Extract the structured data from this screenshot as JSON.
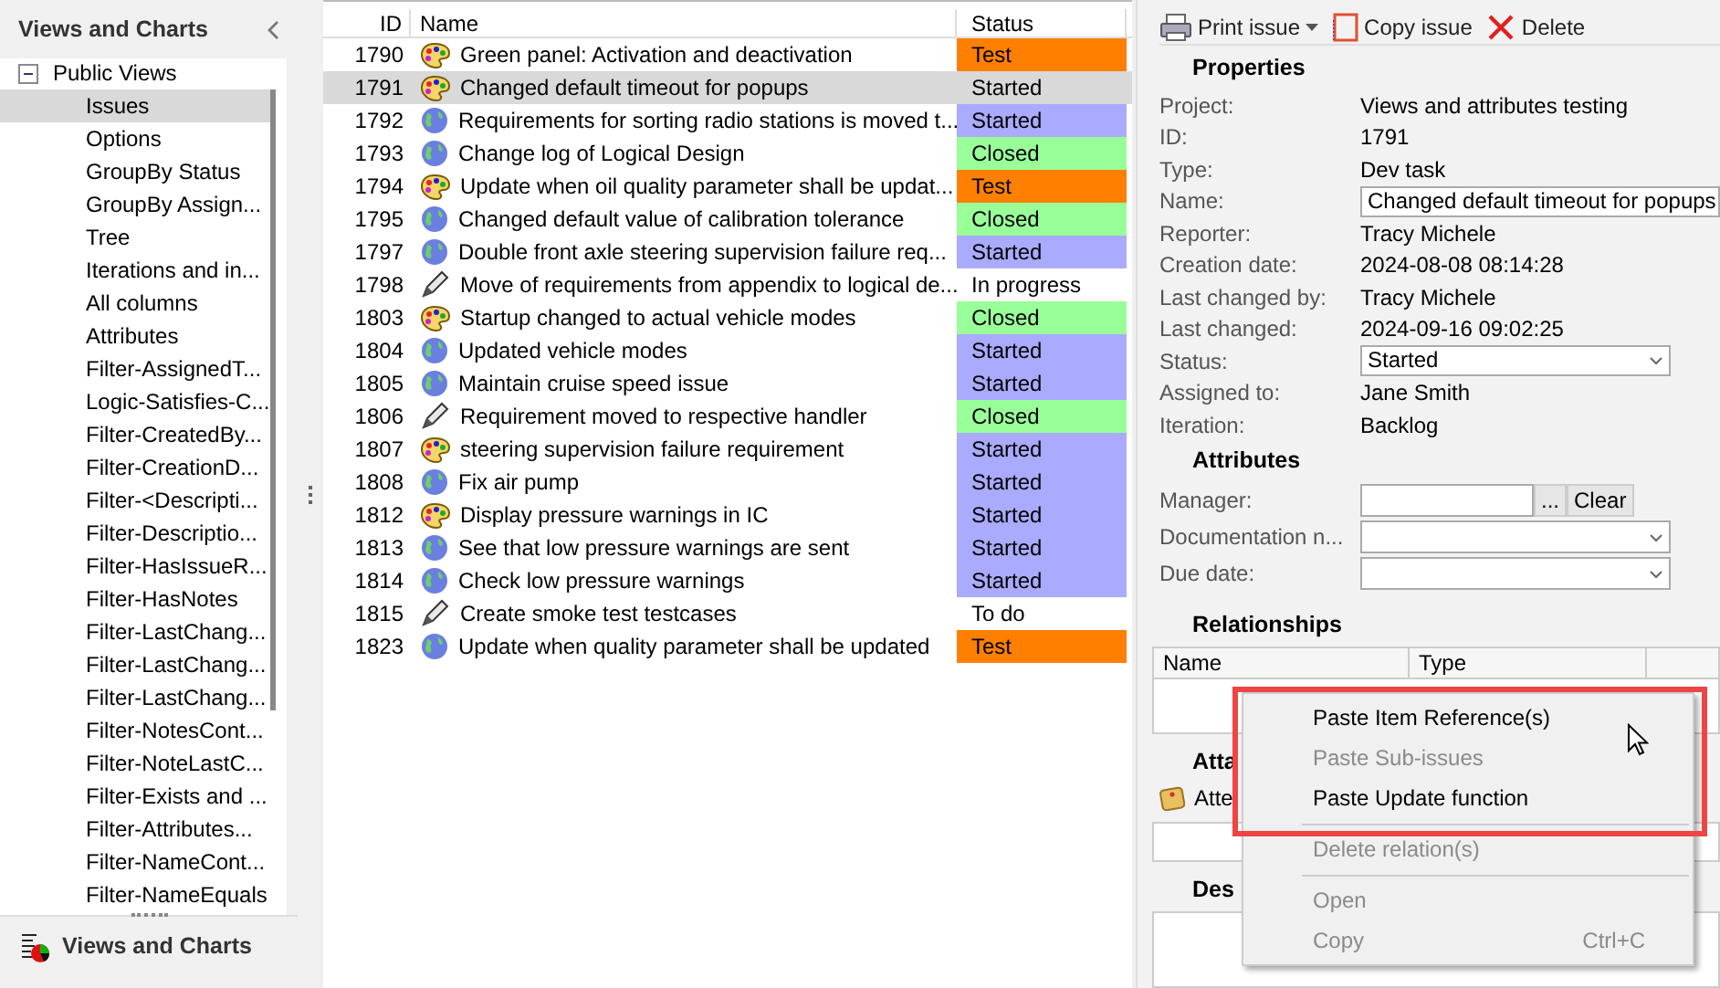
{
  "sidebar": {
    "title": "Views and Charts",
    "tree": [
      {
        "label": "Public Views",
        "expanded": true,
        "children": [
          {
            "label": "Issues",
            "selected": true
          },
          {
            "label": "Options",
            "selected": false
          },
          {
            "label": "GroupBy Status",
            "selected": false
          },
          {
            "label": "GroupBy Assign...",
            "selected": false
          },
          {
            "label": "Tree",
            "selected": false
          },
          {
            "label": "Iterations and in...",
            "selected": false
          },
          {
            "label": "All columns",
            "selected": false
          },
          {
            "label": "Attributes",
            "selected": false
          },
          {
            "label": "Filter-AssignedT...",
            "selected": false
          },
          {
            "label": "Logic-Satisfies-C...",
            "selected": false
          },
          {
            "label": "Filter-CreatedBy...",
            "selected": false
          },
          {
            "label": "Filter-CreationD...",
            "selected": false
          },
          {
            "label": "Filter-<Descripti...",
            "selected": false
          },
          {
            "label": "Filter-Descriptio...",
            "selected": false
          },
          {
            "label": "Filter-HasIssueR...",
            "selected": false
          },
          {
            "label": "Filter-HasNotes",
            "selected": false
          },
          {
            "label": "Filter-LastChang...",
            "selected": false
          },
          {
            "label": "Filter-LastChang...",
            "selected": false
          },
          {
            "label": "Filter-LastChang...",
            "selected": false
          },
          {
            "label": "Filter-NotesCont...",
            "selected": false
          },
          {
            "label": "Filter-NoteLastC...",
            "selected": false
          },
          {
            "label": "Filter-Exists and ...",
            "selected": false
          },
          {
            "label": "Filter-Attributes...",
            "selected": false
          },
          {
            "label": "Filter-NameCont...",
            "selected": false
          },
          {
            "label": "Filter-NameEquals",
            "selected": false
          }
        ]
      }
    ],
    "footer": "Views and Charts"
  },
  "table": {
    "columns": [
      "ID",
      "Name",
      "Status"
    ],
    "rows": [
      {
        "id": "1790",
        "kind": "palette",
        "name": "Green panel: Activation and deactivation",
        "status": "Test",
        "color": "#ff8000",
        "selected": false
      },
      {
        "id": "1791",
        "kind": "palette",
        "name": "Changed default timeout for popups",
        "status": "Started",
        "selected": true
      },
      {
        "id": "1792",
        "kind": "globe",
        "name": "Requirements for sorting radio stations is moved t...",
        "status": "Started",
        "color": "#aaaaff",
        "selected": false
      },
      {
        "id": "1793",
        "kind": "globe",
        "name": "Change log of Logical Design",
        "status": "Closed",
        "color": "#99ff99",
        "selected": false
      },
      {
        "id": "1794",
        "kind": "palette",
        "name": "Update when oil quality parameter shall be updat...",
        "status": "Test",
        "color": "#ff8000",
        "selected": false
      },
      {
        "id": "1795",
        "kind": "globe",
        "name": "Changed default value of calibration tolerance",
        "status": "Closed",
        "color": "#99ff99",
        "selected": false
      },
      {
        "id": "1797",
        "kind": "globe",
        "name": "Double front axle steering supervision failure req...",
        "status": "Started",
        "color": "#aaaaff",
        "selected": false
      },
      {
        "id": "1798",
        "kind": "pencil",
        "name": "Move of requirements from appendix to logical de...",
        "status": "In progress",
        "selected": false
      },
      {
        "id": "1803",
        "kind": "palette",
        "name": "Startup changed to actual vehicle modes",
        "status": "Closed",
        "color": "#99ff99",
        "selected": false
      },
      {
        "id": "1804",
        "kind": "globe",
        "name": "Updated vehicle modes",
        "status": "Started",
        "color": "#aaaaff",
        "selected": false
      },
      {
        "id": "1805",
        "kind": "globe",
        "name": "Maintain cruise speed issue",
        "status": "Started",
        "color": "#aaaaff",
        "selected": false
      },
      {
        "id": "1806",
        "kind": "pencil",
        "name": "Requirement moved to respective handler",
        "status": "Closed",
        "color": "#99ff99",
        "selected": false
      },
      {
        "id": "1807",
        "kind": "palette",
        "name": "steering supervision failure requirement",
        "status": "Started",
        "color": "#aaaaff",
        "selected": false
      },
      {
        "id": "1808",
        "kind": "globe",
        "name": "Fix air pump",
        "status": "Started",
        "color": "#aaaaff",
        "selected": false
      },
      {
        "id": "1812",
        "kind": "palette",
        "name": "Display pressure warnings in IC",
        "status": "Started",
        "color": "#aaaaff",
        "selected": false
      },
      {
        "id": "1813",
        "kind": "globe",
        "name": "See that low pressure warnings are sent",
        "status": "Started",
        "color": "#aaaaff",
        "selected": false
      },
      {
        "id": "1814",
        "kind": "globe",
        "name": "Check low pressure warnings",
        "status": "Started",
        "color": "#aaaaff",
        "selected": false
      },
      {
        "id": "1815",
        "kind": "pencil",
        "name": "Create smoke test testcases",
        "status": "To do",
        "selected": false
      },
      {
        "id": "1823",
        "kind": "globe",
        "name": "Update when quality parameter shall be updated",
        "status": "Test",
        "color": "#ff8000",
        "selected": false
      }
    ]
  },
  "toolbar": [
    {
      "kind": "printer",
      "label": "Print issue",
      "dropdown": true
    },
    {
      "kind": "copy",
      "label": "Copy issue"
    },
    {
      "kind": "delete",
      "label": "Delete"
    }
  ],
  "properties": {
    "title": "Properties",
    "fields": [
      {
        "kind": "text",
        "label": "Project:",
        "value": "Views and attributes testing"
      },
      {
        "kind": "text",
        "label": "ID:",
        "value": "1791"
      },
      {
        "kind": "text",
        "label": "Type:",
        "value": "Dev task"
      },
      {
        "kind": "input",
        "label": "Name:",
        "value": "Changed default timeout for popups"
      },
      {
        "kind": "text",
        "label": "Reporter:",
        "value": "Tracy Michele"
      },
      {
        "kind": "text",
        "label": "Creation date:",
        "value": "2024-08-08 08:14:28"
      },
      {
        "kind": "text",
        "label": "Last changed by:",
        "value": "Tracy Michele"
      },
      {
        "kind": "text",
        "label": "Last changed:",
        "value": "2024-09-16 09:02:25"
      },
      {
        "kind": "select",
        "label": "Status:",
        "value": "Started"
      },
      {
        "kind": "text",
        "label": "Assigned to:",
        "value": "Jane Smith"
      },
      {
        "kind": "text",
        "label": "Iteration:",
        "value": "Backlog"
      }
    ]
  },
  "attributes": {
    "title": "Attributes",
    "fields": [
      {
        "kind": "picker",
        "label": "Manager:",
        "buttons": [
          "...",
          "Clear"
        ]
      },
      {
        "kind": "select",
        "label": "Documentation n..."
      },
      {
        "kind": "select",
        "label": "Due date:"
      }
    ]
  },
  "relationships": {
    "title": "Relationships",
    "columns": [
      "Name",
      "Type"
    ]
  },
  "attachments": {
    "title": "Atta",
    "link": "Atte"
  },
  "description": {
    "title": "Des"
  },
  "context_menu": {
    "items": [
      {
        "kind": "item",
        "label": "Paste Item Reference(s)",
        "disabled": false
      },
      {
        "kind": "item",
        "label": "Paste Sub-issues",
        "disabled": true
      },
      {
        "kind": "item",
        "label": "Paste Update function",
        "disabled": false
      },
      {
        "kind": "separator"
      },
      {
        "kind": "item",
        "label": "Delete relation(s)",
        "disabled": true
      },
      {
        "kind": "separator"
      },
      {
        "kind": "item",
        "label": "Open",
        "disabled": true
      },
      {
        "kind": "item",
        "label": "Copy",
        "shortcut": "Ctrl+C",
        "disabled": true
      }
    ]
  }
}
